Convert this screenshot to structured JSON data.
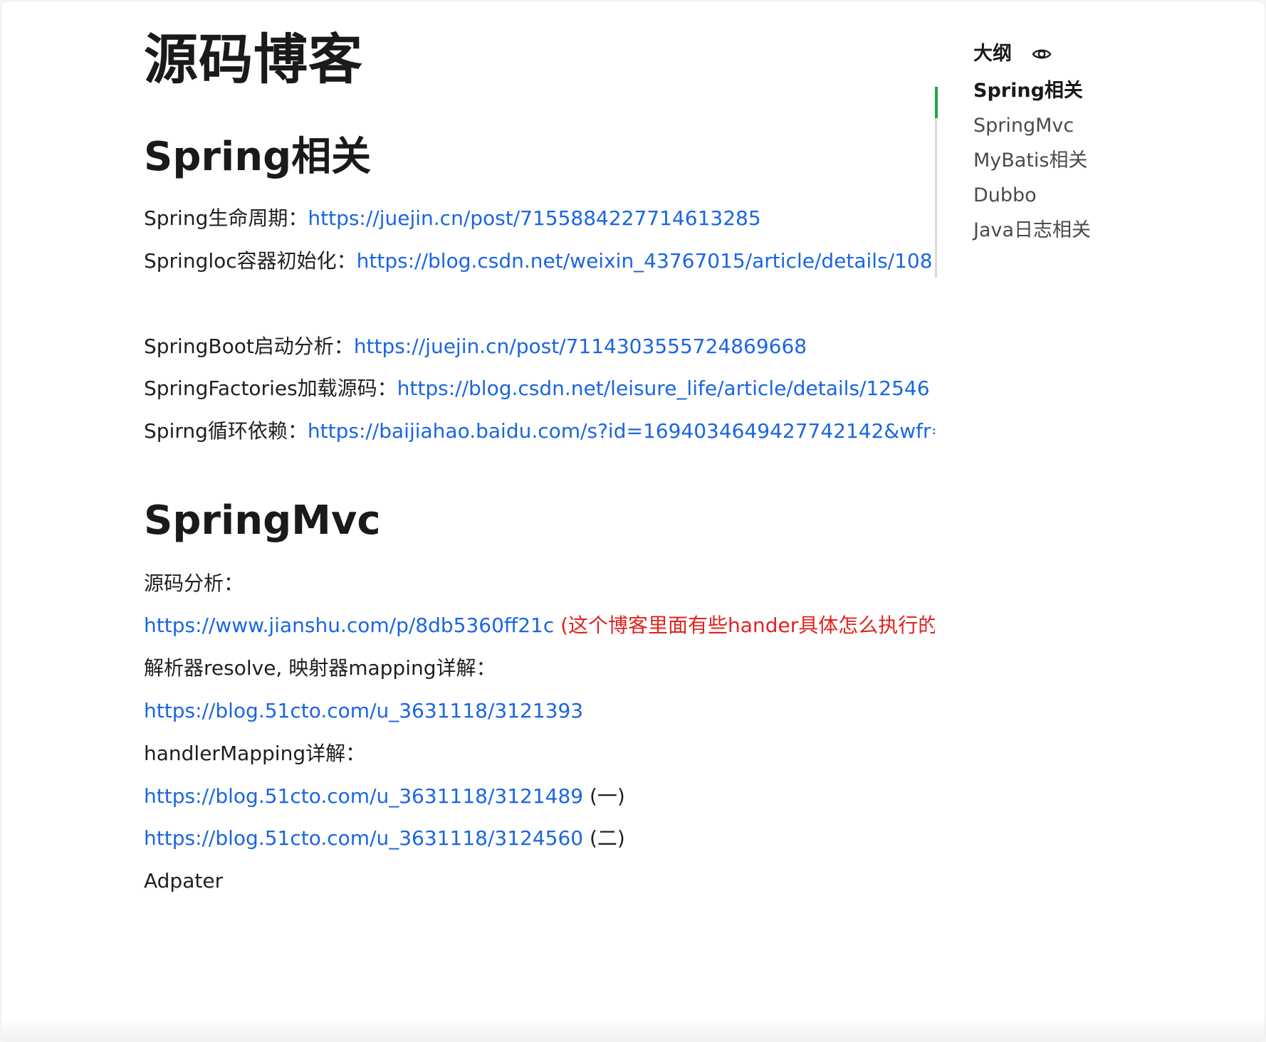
{
  "document": {
    "title": "源码博客"
  },
  "sections": [
    {
      "heading": "Spring相关",
      "lines": [
        {
          "label": "Spring生命周期：",
          "url": "https://juejin.cn/post/7155884227714613285"
        },
        {
          "label": "Springloc容器初始化：",
          "url": "https://blog.csdn.net/weixin_43767015/article/details/108"
        },
        {
          "label": "SpringBoot启动分析：",
          "url": "https://juejin.cn/post/7114303555724869668"
        },
        {
          "label": "SpringFactories加载源码：",
          "url": "https://blog.csdn.net/leisure_life/article/details/12546"
        },
        {
          "label": "Spirng循环依赖：",
          "url": "https://baijiahao.baidu.com/s?id=1694034649427742142&wfr="
        }
      ]
    },
    {
      "heading": "SpringMvc",
      "lines": [
        {
          "label": "源码分析："
        },
        {
          "url": "https://www.jianshu.com/p/8db5360ff21c",
          "paren": " (",
          "note": "这个博客里面有些hander具体怎么执行的"
        },
        {
          "label": "解析器resolve, 映射器mapping详解："
        },
        {
          "url": "https://blog.51cto.com/u_3631118/3121393"
        },
        {
          "label": "handlerMapping详解："
        },
        {
          "url": "https://blog.51cto.com/u_3631118/3121489",
          "suffix": "  (一)"
        },
        {
          "url": "https://blog.51cto.com/u_3631118/3124560",
          "suffix": "  (二)"
        },
        {
          "label": "Adpater"
        }
      ]
    }
  ],
  "outline": {
    "title": "大纲",
    "icon": "eye-icon",
    "items": [
      {
        "label": "Spring相关",
        "active": true
      },
      {
        "label": "SpringMvc",
        "active": false
      },
      {
        "label": "MyBatis相关",
        "active": false
      },
      {
        "label": "Dubbo",
        "active": false
      },
      {
        "label": "Java日志相关",
        "active": false
      }
    ]
  },
  "colors": {
    "link": "#1a66e0",
    "note": "#e0231f",
    "outline_active_indicator": "#1fa34a",
    "text": "#1f1f1f"
  }
}
